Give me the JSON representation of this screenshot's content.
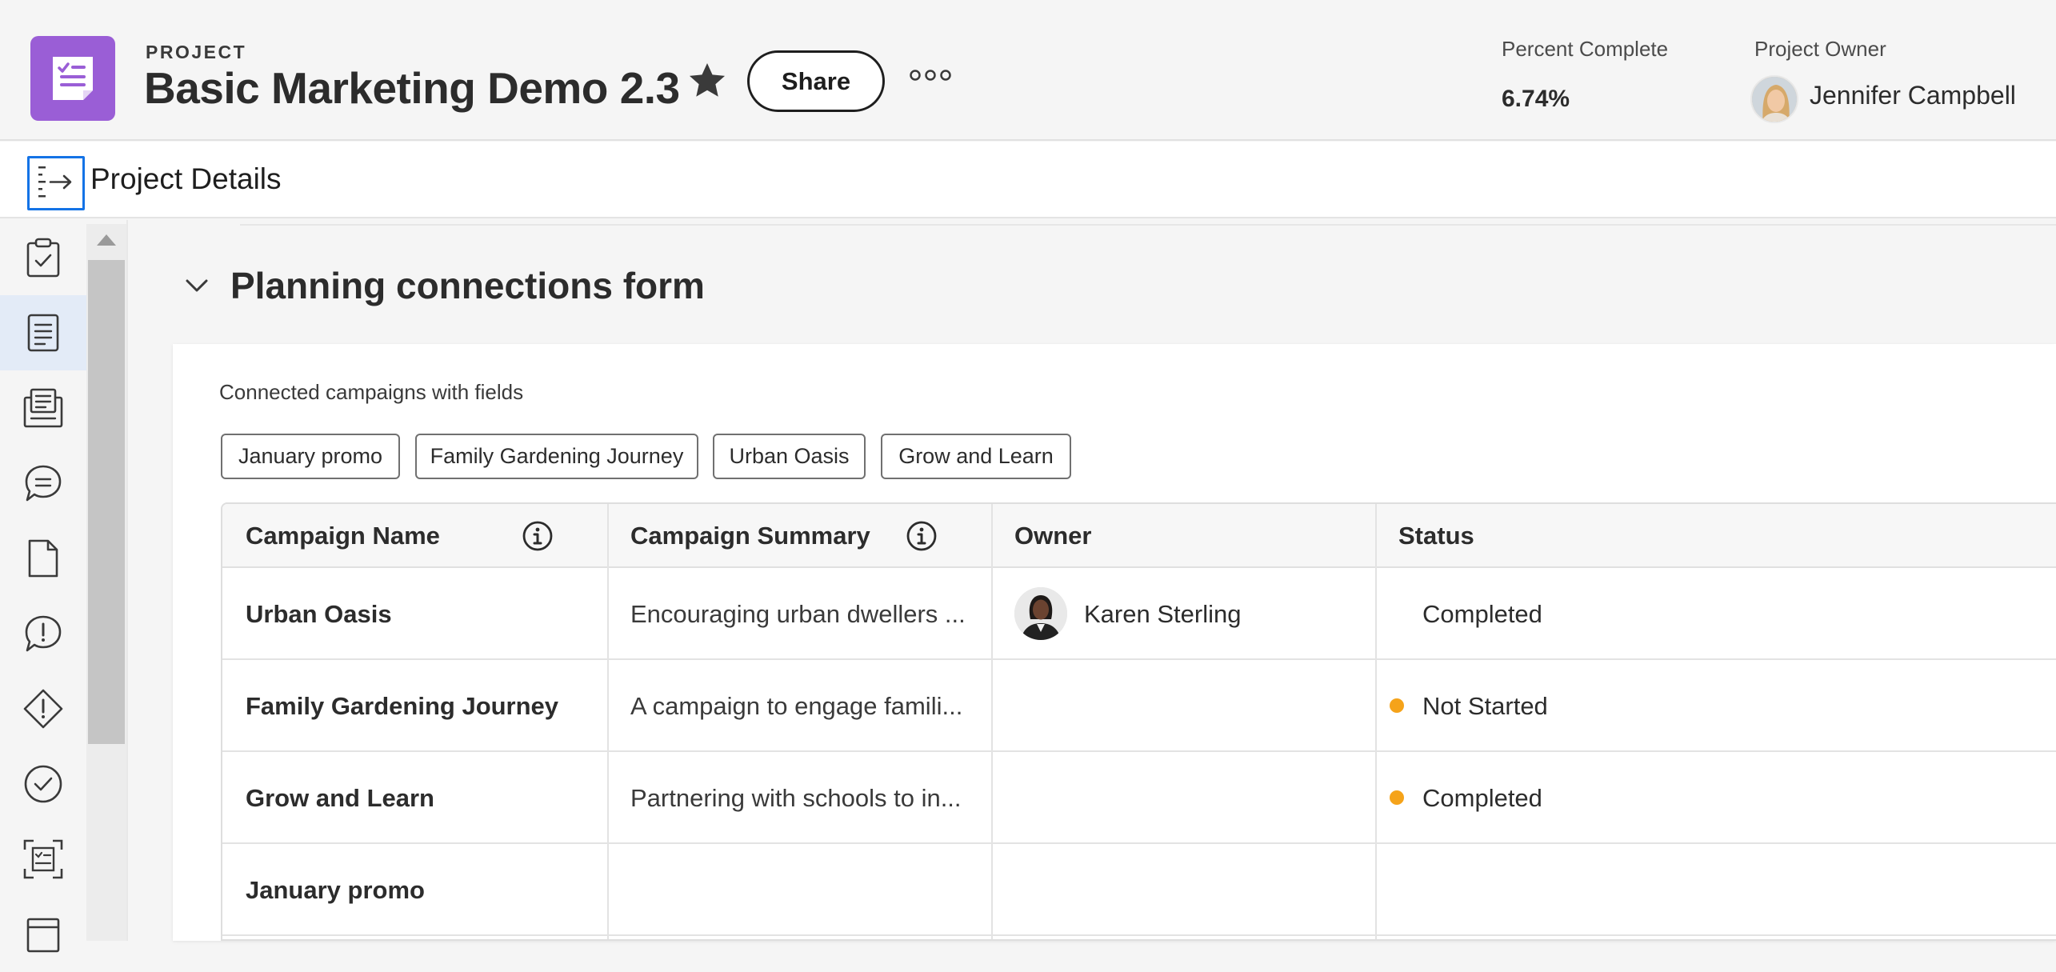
{
  "header": {
    "kicker": "PROJECT",
    "title": "Basic Marketing Demo 2.3",
    "share_label": "Share",
    "percent_complete_label": "Percent Complete",
    "percent_complete_value": "6.74%",
    "project_owner_label": "Project Owner",
    "project_owner_name": "Jennifer Campbell",
    "icon_color": "#9a5ed6"
  },
  "details": {
    "title": "Project Details"
  },
  "rail": {
    "items": [
      {
        "icon": "clipboard-check-icon"
      },
      {
        "icon": "document-lines-icon",
        "active": true
      },
      {
        "icon": "stacked-documents-icon"
      },
      {
        "icon": "chat-bubble-icon"
      },
      {
        "icon": "blank-document-icon"
      },
      {
        "icon": "alert-bubble-icon"
      },
      {
        "icon": "diamond-alert-icon"
      },
      {
        "icon": "check-circle-icon"
      },
      {
        "icon": "checklist-frame-icon"
      },
      {
        "icon": "calendar-icon"
      }
    ]
  },
  "section": {
    "title": "Planning connections form",
    "card_label": "Connected campaigns with fields",
    "chips": [
      "January promo",
      "Family Gardening Journey",
      "Urban Oasis",
      "Grow and Learn"
    ]
  },
  "table": {
    "columns": [
      "Campaign Name",
      "Campaign Summary",
      "Owner",
      "Status"
    ],
    "rows": [
      {
        "name": "Urban Oasis",
        "summary": "Encouraging urban dwellers ...",
        "owner": "Karen Sterling",
        "status": "Completed",
        "status_dot": false
      },
      {
        "name": "Family Gardening Journey",
        "summary": "A campaign to engage famili...",
        "owner": "",
        "status": "Not Started",
        "status_dot": true
      },
      {
        "name": "Grow and Learn",
        "summary": "Partnering with schools to in...",
        "owner": "",
        "status": "Completed",
        "status_dot": true
      },
      {
        "name": "January promo",
        "summary": "",
        "owner": "",
        "status": "",
        "status_dot": false
      }
    ],
    "status_dot_color": "#f5a31a"
  }
}
